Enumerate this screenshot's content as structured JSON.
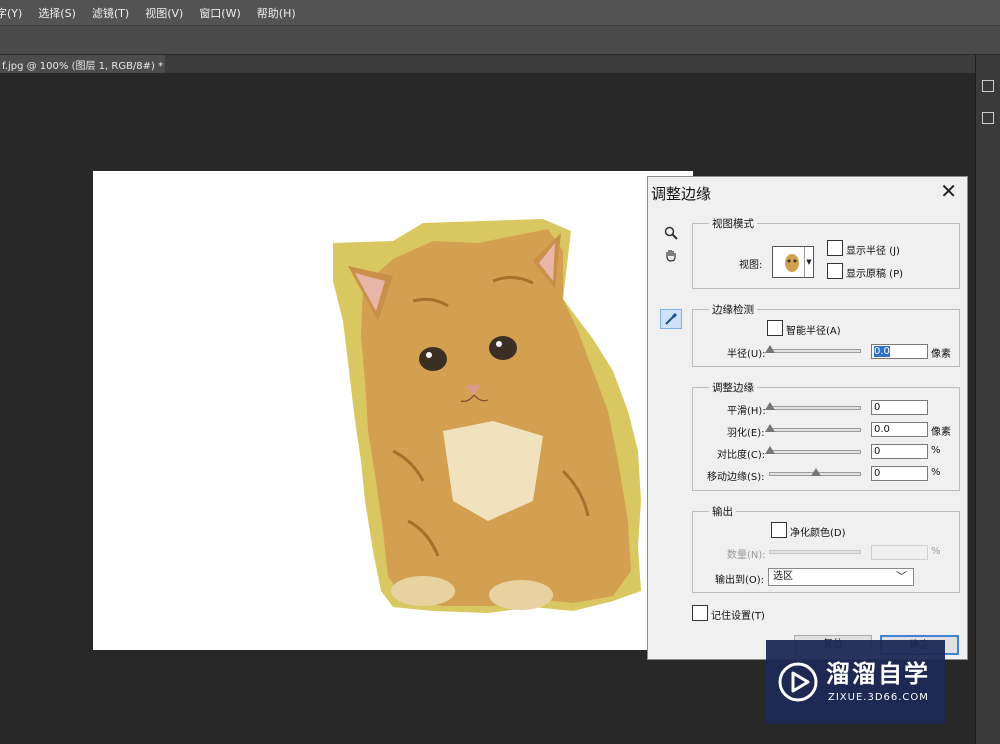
{
  "menu": [
    "字(Y)",
    "选择(S)",
    "滤镜(T)",
    "视图(V)",
    "窗口(W)",
    "帮助(H)"
  ],
  "document_tab": {
    "title": "f.jpg @ 100% (图层 1, RGB/8#) *",
    "close": "×"
  },
  "dialog": {
    "title": "调整边缘",
    "close": "✕",
    "view_mode": {
      "group": "视图模式",
      "view_label": "视图:",
      "show_radius": "显示半径 (J)",
      "show_original": "显示原稿 (P)"
    },
    "edge_detection": {
      "group": "边缘检测",
      "smart_radius": "智能半径(A)",
      "radius_label": "半径(U):",
      "radius_value": "0.0",
      "radius_unit": "像素"
    },
    "adjust_edge": {
      "group": "调整边缘",
      "smooth_label": "平滑(H):",
      "smooth_value": "0",
      "feather_label": "羽化(E):",
      "feather_value": "0.0",
      "feather_unit": "像素",
      "contrast_label": "对比度(C):",
      "contrast_value": "0",
      "contrast_unit": "%",
      "shift_label": "移动边缘(S):",
      "shift_value": "0",
      "shift_unit": "%"
    },
    "output": {
      "group": "输出",
      "decontaminate": "净化颜色(D)",
      "amount_label": "数量(N):",
      "amount_unit": "%",
      "output_to_label": "输出到(O):",
      "output_to_value": "选区"
    },
    "remember": "记住设置(T)",
    "buttons": {
      "reset": "复位",
      "ok": "确定"
    }
  },
  "watermark": {
    "title": "溜溜自学",
    "subtitle": "ZIXUE.3D66.COM"
  },
  "icons": [
    "zoom-icon",
    "hand-icon",
    "refine-radius-brush-icon",
    "play-logo-icon"
  ]
}
